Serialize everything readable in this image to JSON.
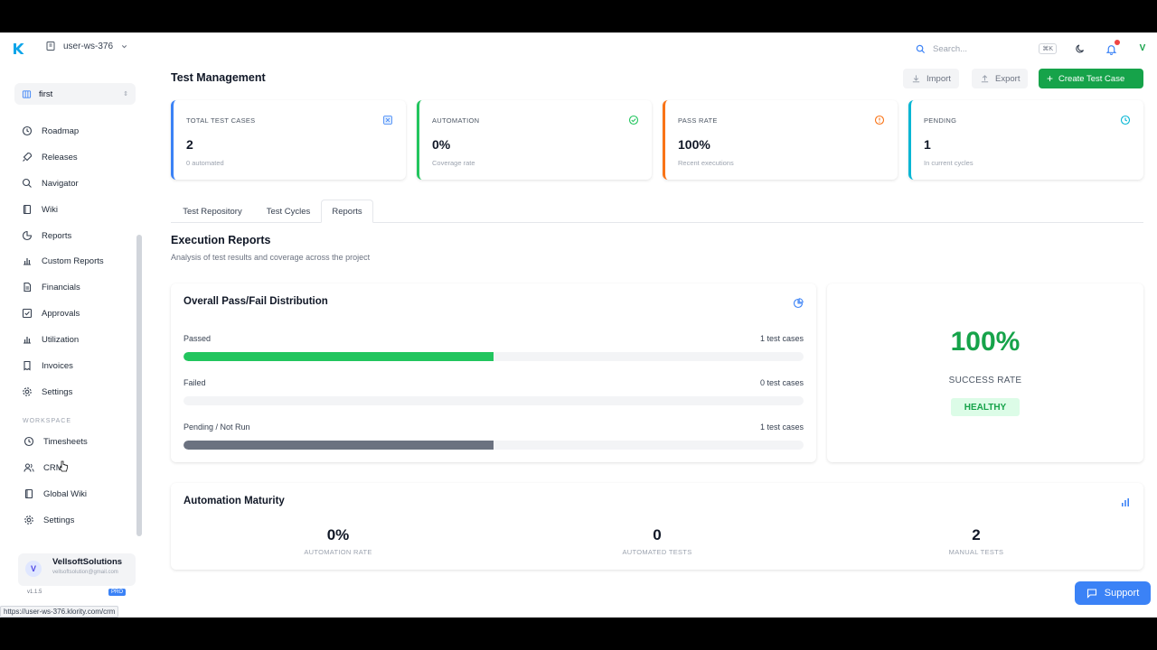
{
  "topbar": {
    "workspace": "user-ws-376",
    "search_placeholder": "Search...",
    "search_shortcut": "⌘K",
    "user_initial": "V"
  },
  "sidebar": {
    "project": "first",
    "items": [
      {
        "label": "Roadmap",
        "icon": "clock-icon"
      },
      {
        "label": "Releases",
        "icon": "rocket-icon"
      },
      {
        "label": "Navigator",
        "icon": "search-icon"
      },
      {
        "label": "Wiki",
        "icon": "book-icon"
      },
      {
        "label": "Reports",
        "icon": "pie-chart-icon"
      },
      {
        "label": "Custom Reports",
        "icon": "bar-chart-icon"
      },
      {
        "label": "Financials",
        "icon": "document-icon"
      },
      {
        "label": "Approvals",
        "icon": "check-square-icon"
      },
      {
        "label": "Utilization",
        "icon": "bar-chart-icon"
      },
      {
        "label": "Invoices",
        "icon": "receipt-icon"
      },
      {
        "label": "Settings",
        "icon": "gear-icon"
      }
    ],
    "workspace_label": "WORKSPACE",
    "workspace_items": [
      {
        "label": "Timesheets",
        "icon": "clock-icon"
      },
      {
        "label": "CRM",
        "icon": "users-icon"
      },
      {
        "label": "Global Wiki",
        "icon": "book-icon"
      },
      {
        "label": "Settings",
        "icon": "gear-icon"
      }
    ],
    "user": {
      "initial": "V",
      "name": "VellsoftSolutions",
      "email": "vellsoftsolution@gmail.com"
    },
    "version": "v1.1.5",
    "plan": "PRO",
    "status_url": "https://user-ws-376.klority.com/crm"
  },
  "header": {
    "title": "Test Management",
    "import_label": "Import",
    "export_label": "Export",
    "create_label": "Create Test Case"
  },
  "stats": [
    {
      "label": "TOTAL TEST CASES",
      "value": "2",
      "sub": "0 automated",
      "color": "#3b82f6",
      "icon": "test-tube-icon"
    },
    {
      "label": "AUTOMATION",
      "value": "0%",
      "sub": "Coverage rate",
      "color": "#22c55e",
      "icon": "check-circle-icon"
    },
    {
      "label": "PASS RATE",
      "value": "100%",
      "sub": "Recent executions",
      "color": "#f97316",
      "icon": "alert-circle-icon"
    },
    {
      "label": "PENDING",
      "value": "1",
      "sub": "In current cycles",
      "color": "#06b6d4",
      "icon": "clock-icon"
    }
  ],
  "tabs": [
    "Test Repository",
    "Test Cycles",
    "Reports"
  ],
  "reports": {
    "title": "Execution Reports",
    "subtitle": "Analysis of test results and coverage across the project"
  },
  "distribution": {
    "title": "Overall Pass/Fail Distribution",
    "rows": [
      {
        "label": "Passed",
        "count": "1 test cases",
        "fraction": 0.5,
        "color": "#22c55e"
      },
      {
        "label": "Failed",
        "count": "0 test cases",
        "fraction": 0,
        "color": "#ef4444"
      },
      {
        "label": "Pending / Not Run",
        "count": "1 test cases",
        "fraction": 0.5,
        "color": "#6b7280"
      }
    ]
  },
  "success": {
    "value": "100%",
    "label": "SUCCESS RATE",
    "badge": "HEALTHY"
  },
  "maturity": {
    "title": "Automation Maturity",
    "metrics": [
      {
        "value": "0%",
        "label": "AUTOMATION RATE"
      },
      {
        "value": "0",
        "label": "AUTOMATED TESTS"
      },
      {
        "value": "2",
        "label": "MANUAL TESTS"
      }
    ]
  },
  "support_label": "Support"
}
